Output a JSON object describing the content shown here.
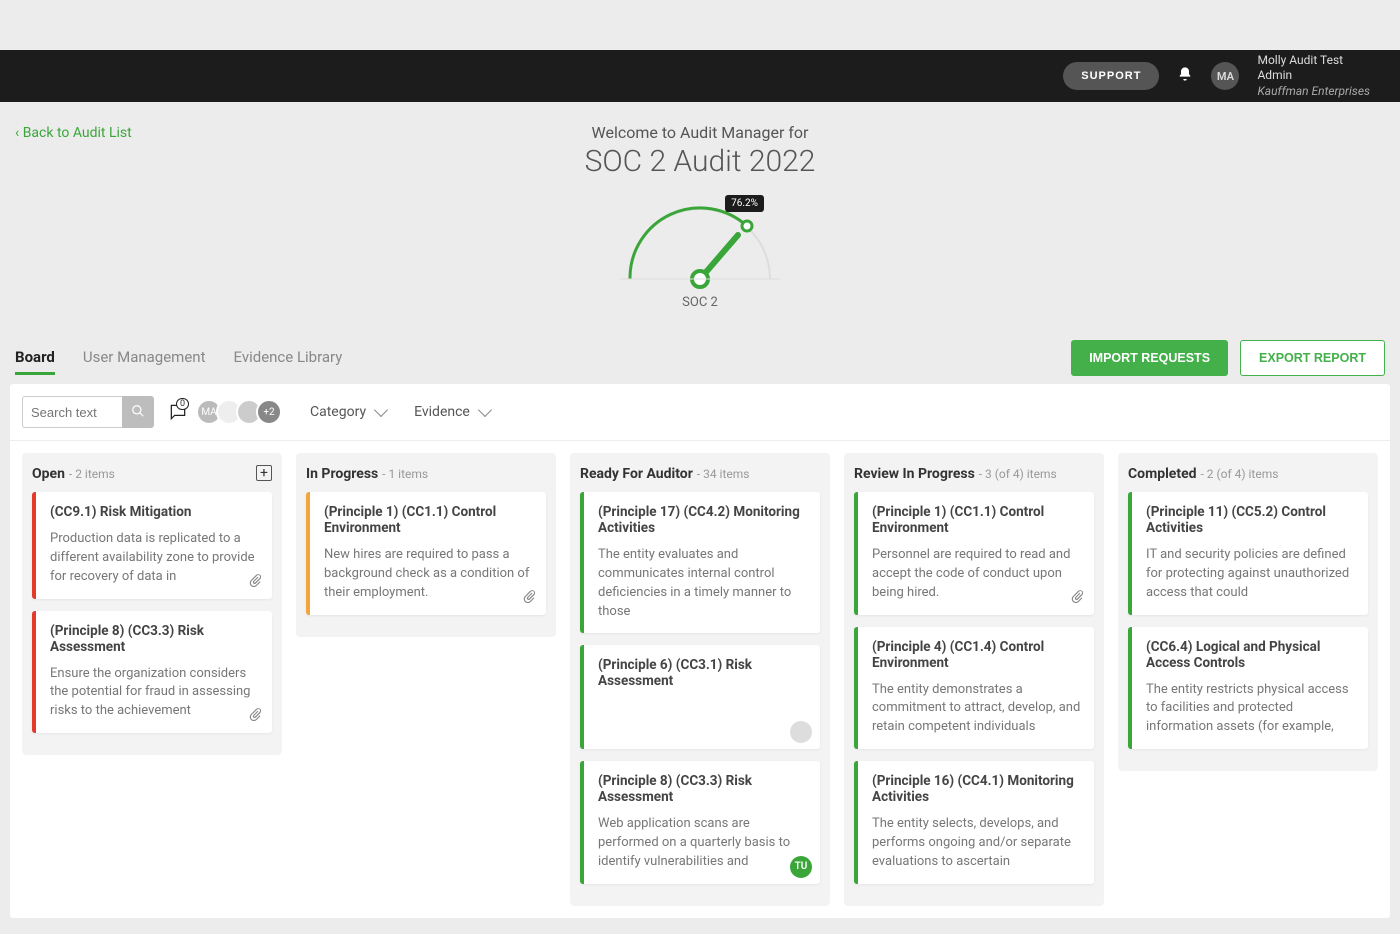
{
  "topbar": {
    "support_label": "SUPPORT",
    "avatar_initials": "MA",
    "user_name": "Molly Audit Test",
    "user_role": "Admin",
    "org": "Kauffman Enterprises"
  },
  "backlink_label": "Back to Audit List",
  "welcome": {
    "prefix": "Welcome to Audit Manager for",
    "title": "SOC 2 Audit 2022",
    "gauge_percent": "76.2%",
    "gauge_label": "SOC 2"
  },
  "tabs": {
    "board": "Board",
    "user_mgmt": "User Management",
    "evidence_lib": "Evidence Library"
  },
  "buttons": {
    "import": "IMPORT REQUESTS",
    "export": "EXPORT REPORT"
  },
  "filters": {
    "search_placeholder": "Search text",
    "comment_count": "0",
    "stack_more": "+2",
    "category_label": "Category",
    "evidence_label": "Evidence"
  },
  "columns": [
    {
      "title": "Open",
      "count": "- 2 items",
      "show_plus": true,
      "accent": "red",
      "cards": [
        {
          "title": "(CC9.1) Risk Mitigation",
          "body": "Production data is replicated to a different availability zone to provide for recovery of data in",
          "clip": true
        },
        {
          "title": "(Principle 8) (CC3.3) Risk Assessment",
          "body": "Ensure the organization considers the potential for fraud in assessing risks to the achievement",
          "clip": true
        }
      ]
    },
    {
      "title": "In Progress",
      "count": "- 1 items",
      "accent": "orange",
      "cards": [
        {
          "title": "(Principle 1) (CC1.1) Control Environment",
          "body": "New hires are required to pass a background check as a condition of their employment.",
          "clip": true
        }
      ]
    },
    {
      "title": "Ready For Auditor",
      "count": "- 34 items",
      "accent": "green",
      "cards": [
        {
          "title": "(Principle 17) (CC4.2) Monitoring Activities",
          "body": "The entity evaluates and communicates internal control deficiencies in a timely manner to those"
        },
        {
          "title": "(Principle 6) (CC3.1) Risk Assessment",
          "body": "",
          "clip": true,
          "gray_av": true
        },
        {
          "title": "(Principle 8) (CC3.3) Risk Assessment",
          "body": "Web application scans are performed on a quarterly basis to identify vulnerabilities and",
          "mini_av": "TU"
        }
      ]
    },
    {
      "title": "Review In Progress",
      "count": "- 3 (of 4) items",
      "accent": "green",
      "cards": [
        {
          "title": "(Principle 1) (CC1.1) Control Environment",
          "body": "Personnel are required to read and accept the code of conduct upon being hired.",
          "clip": true
        },
        {
          "title": "(Principle 4) (CC1.4) Control Environment",
          "body": "The entity demonstrates a commitment to attract, develop, and retain competent individuals"
        },
        {
          "title": "(Principle 16) (CC4.1) Monitoring Activities",
          "body": "The entity selects, develops, and performs ongoing and/or separate evaluations to ascertain"
        }
      ]
    },
    {
      "title": "Completed",
      "count": "- 2 (of 4) items",
      "accent": "green",
      "cards": [
        {
          "title": "(Principle 11) (CC5.2) Control Activities",
          "body": "IT and security policies are defined for protecting against unauthorized access that could"
        },
        {
          "title": "(CC6.4) Logical and Physical Access Controls",
          "body": "The entity restricts physical access to facilities and protected information assets (for example,"
        }
      ]
    }
  ]
}
